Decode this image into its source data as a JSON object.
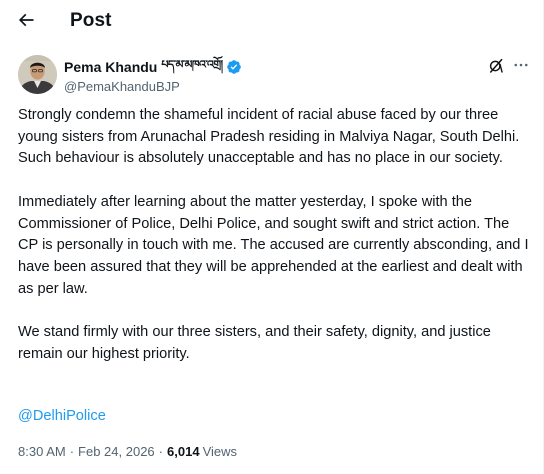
{
  "header": {
    "title": "Post",
    "back_icon": "arrow-left-icon"
  },
  "author": {
    "display_name": "Pema Khandu",
    "native_script_name": "པད་མ་མཁའ་འགྲོ།",
    "handle": "@PemaKhanduBJP",
    "verified": true,
    "verified_color": "#1d9bf0"
  },
  "actions": {
    "grok_icon": "grok-icon",
    "more_icon": "more-horizontal-icon"
  },
  "tweet": {
    "paragraphs": [
      "Strongly condemn the shameful incident of racial abuse faced by our three young sisters from Arunachal Pradesh residing in Malviya Nagar, South Delhi. Such behaviour is absolutely unacceptable and has no place in our society.",
      "Immediately after learning about the matter yesterday, I spoke with the Commissioner of Police, Delhi Police, and sought swift and strict action. The CP is personally in touch with me. The accused are currently absconding, and I have been assured that they will be apprehended at the earliest and dealt with as per law.",
      "We stand firmly with our three sisters, and their safety, dignity, and justice remain our highest priority."
    ],
    "mention": "@DelhiPolice",
    "mention_color": "#1d9bf0"
  },
  "meta": {
    "time": "8:30 AM",
    "separator": "·",
    "date": "Feb 24, 2026",
    "views_count": "6,014",
    "views_label": "Views"
  }
}
